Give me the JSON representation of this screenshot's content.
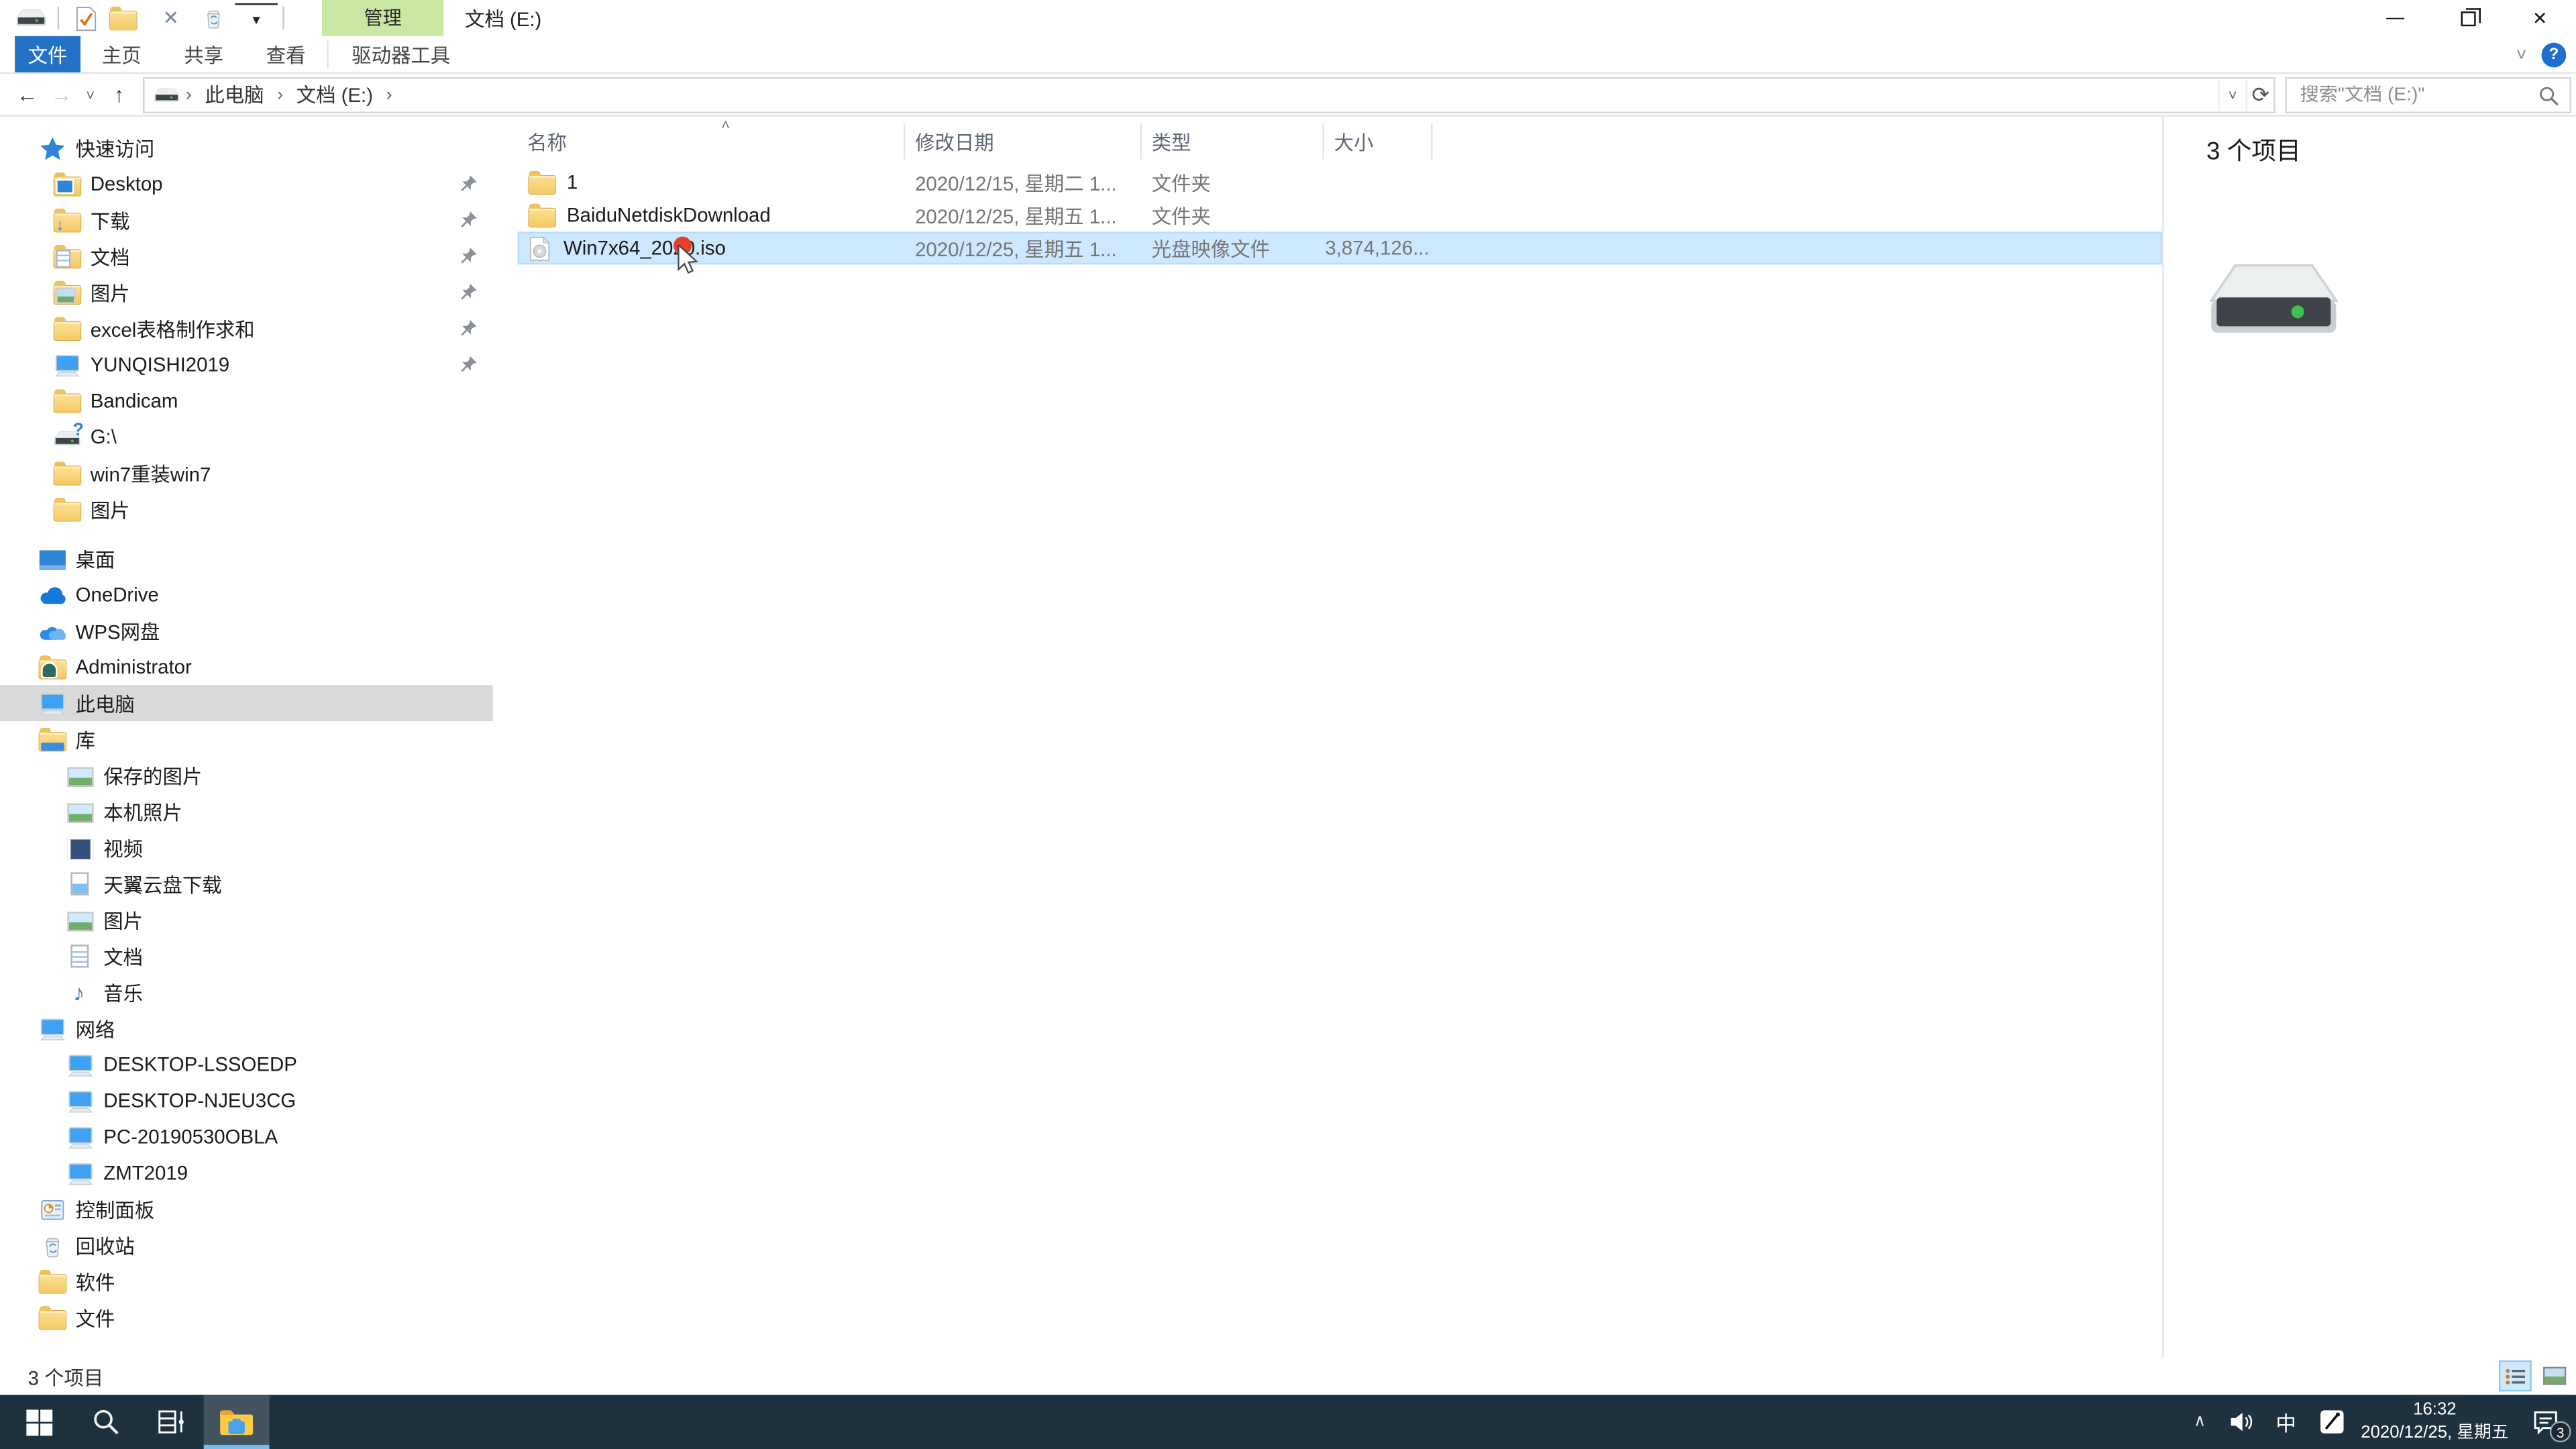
{
  "window": {
    "title": "文档 (E:)",
    "contextual_header": "管理"
  },
  "tabs": {
    "file": "文件",
    "items": [
      "主页",
      "共享",
      "查看"
    ],
    "contextual": "驱动器工具"
  },
  "address": {
    "crumbs": [
      "此电脑",
      "文档 (E:)"
    ]
  },
  "search": {
    "placeholder": "搜索\"文档 (E:)\""
  },
  "sidebar": {
    "items": [
      "快速访问",
      "Desktop",
      "下载",
      "文档",
      "图片",
      "excel表格制作求和",
      "YUNQISHI2019",
      "Bandicam",
      "G:\\",
      "win7重装win7",
      "图片",
      "桌面",
      "OneDrive",
      "WPS网盘",
      "Administrator",
      "此电脑",
      "库",
      "保存的图片",
      "本机照片",
      "视频",
      "天翼云盘下载",
      "图片",
      "文档",
      "音乐",
      "网络",
      "DESKTOP-LSSOEDP",
      "DESKTOP-NJEU3CG",
      "PC-20190530OBLA",
      "ZMT2019",
      "控制面板",
      "回收站",
      "软件",
      "文件"
    ]
  },
  "list": {
    "columns": [
      "名称",
      "修改日期",
      "类型",
      "大小"
    ],
    "rows": [
      {
        "name": "1",
        "date": "2020/12/15, 星期二 1...",
        "type": "文件夹",
        "size": ""
      },
      {
        "name": "BaiduNetdiskDownload",
        "date": "2020/12/25, 星期五 1...",
        "type": "文件夹",
        "size": ""
      },
      {
        "name": "Win7x64_2020.iso",
        "date": "2020/12/25, 星期五 1...",
        "type": "光盘映像文件",
        "size": "3,874,126..."
      }
    ]
  },
  "preview": {
    "count": "3 个项目"
  },
  "status": {
    "count": "3 个项目"
  },
  "taskbar": {
    "ime": "中",
    "time": "16:32",
    "date": "2020/12/25, 星期五",
    "badge": "3"
  },
  "glyphs": {
    "qat_dropdown": "▾",
    "qat_close": "✕",
    "minimize": "—",
    "close": "✕",
    "back": "←",
    "forward": "→",
    "up": "↑",
    "chevron_down": "˅",
    "refresh": "⟳",
    "crumb_sep": "›",
    "sort_asc": "˄",
    "help": "?",
    "question": "?",
    "music_note": "♪",
    "tray_chevron": "∧"
  },
  "colors": {
    "accent_blue": "#2472c8",
    "contextual_green": "#c9e8a4",
    "selection_blue": "#cde8ff",
    "sidebar_selected": "#d9d9d9",
    "taskbar": "#1d313f"
  }
}
